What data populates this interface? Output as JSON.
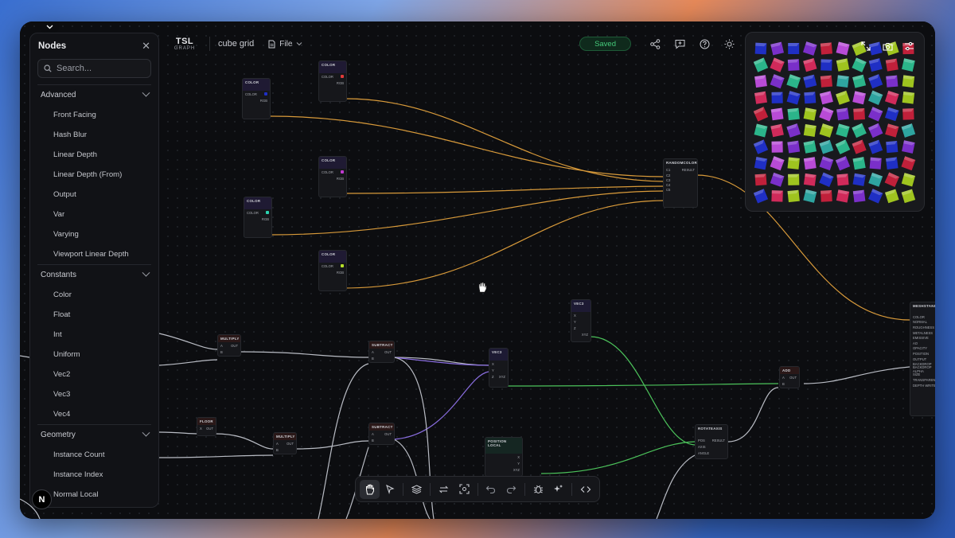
{
  "app": {
    "logo_main": "TSL",
    "logo_sub": "GRAPH",
    "project": "cube grid",
    "file_menu": "File",
    "status": "Saved"
  },
  "sidebar": {
    "title": "Nodes",
    "search_placeholder": "Search...",
    "groups": [
      {
        "label": "Advanced",
        "items": [
          "Front Facing",
          "Hash Blur",
          "Linear Depth",
          "Linear Depth (From)",
          "Output",
          "Var",
          "Varying",
          "Viewport Linear Depth"
        ]
      },
      {
        "label": "Constants",
        "items": [
          "Color",
          "Float",
          "Int",
          "Uniform",
          "Vec2",
          "Vec3",
          "Vec4"
        ]
      },
      {
        "label": "Geometry",
        "items": [
          "Instance Count",
          "Instance Index",
          "Normal Local"
        ]
      }
    ]
  },
  "badge": "N",
  "nodes": {
    "color": "COLOR",
    "color_port": "COLOR",
    "rgb_port": "RGB",
    "random_color": "RANDOMCOLOR",
    "result": "RESULT",
    "c_ports": [
      "C1",
      "C2",
      "C3",
      "C4",
      "C5"
    ],
    "multiply": "MULTIPLY",
    "subtract": "SUBTRACT",
    "floor": "FLOOR",
    "vec3": "VEC3",
    "add": "ADD",
    "position_local": "POSITION LOCAL",
    "rotate": "ROTATEAXIS",
    "a": "A",
    "b": "B",
    "x": "X",
    "y": "Y",
    "z": "Z",
    "out": "OUT",
    "xyz": "XYZ",
    "pos": "POS",
    "axis": "AXIS",
    "angle": "ANGLE",
    "mesh": "MESHSTANDA",
    "mesh_ports": [
      "COLOR",
      "NORMAL",
      "ROUGHNESS",
      "METALNESS",
      "EMISSIVE",
      "AO",
      "OPACITY",
      "POSITION",
      "OUTPUT",
      "BACKDROP",
      "BACKDROP ALPHA",
      "SIZE",
      "TRANSPARENT",
      "DEPTH WRITE"
    ]
  },
  "colors": {
    "accent_green": "#45c97a",
    "wire_orange": "#d89a3a",
    "wire_purple": "#8a6ee0",
    "wire_green": "#4cc35b",
    "wire_gray": "#b9bcc4"
  },
  "preview_palette": [
    "#7a2fc9",
    "#2bb58a",
    "#b84bd6",
    "#1f2fc4",
    "#c0203a",
    "#9fc41f",
    "#2ea4a0",
    "#d02a5a"
  ]
}
